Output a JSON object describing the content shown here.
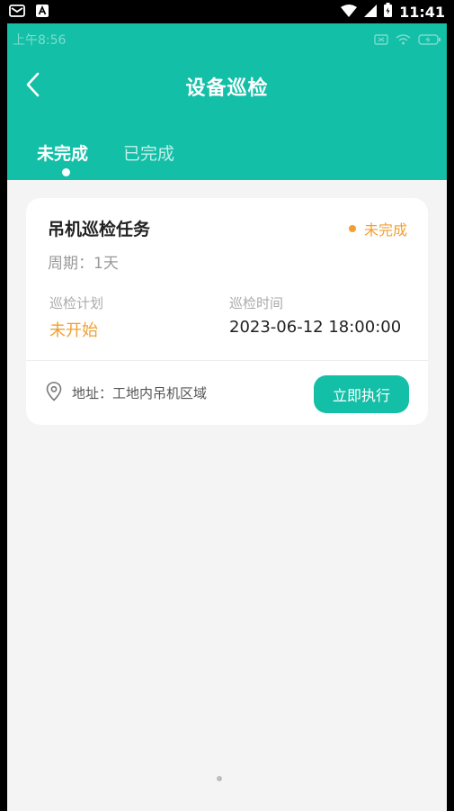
{
  "system_bar": {
    "time": "11:41"
  },
  "inner_status": {
    "time": "上午8:56"
  },
  "header": {
    "title": "设备巡检"
  },
  "tabs": [
    {
      "label": "未完成",
      "active": true
    },
    {
      "label": "已完成",
      "active": false
    }
  ],
  "task_card": {
    "title": "吊机巡检任务",
    "status": "未完成",
    "period": "周期：1天",
    "plan_label": "巡检计划",
    "plan_value": "未开始",
    "time_label": "巡检时间",
    "time_value": "2023-06-12 18:00:00",
    "address": "地址：工地内吊机区域",
    "execute_label": "立即执行"
  },
  "colors": {
    "accent": "#13bfa7",
    "pending": "#f0a032",
    "background": "#f4f4f4"
  },
  "icons": [
    "mail-icon",
    "a-icon",
    "wifi-icon",
    "signal-icon",
    "battery-icon",
    "back-chevron-icon",
    "location-pin-icon"
  ]
}
